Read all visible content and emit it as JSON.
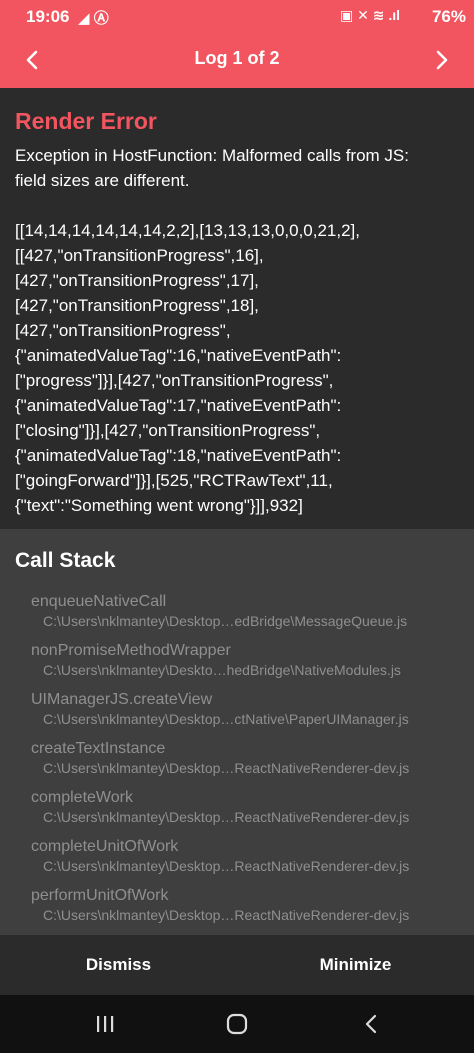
{
  "status_bar": {
    "time": "19:06",
    "left_icons": "◢ Ⓐ",
    "right_icons": "▣ ✕ ≋ .ıl",
    "battery": "76%"
  },
  "header": {
    "title": "Log 1 of 2",
    "prev_icon": "chevron-left-icon",
    "next_icon": "chevron-right-icon",
    "background": "#f2555f"
  },
  "error": {
    "heading": "Render Error",
    "message_lines": [
      "Exception in HostFunction: Malformed calls from JS:",
      "field sizes are different.",
      "",
      "[[14,14,14,14,14,14,2,2],[13,13,13,0,0,0,21,2],",
      "[[427,\"onTransitionProgress\",16],",
      "[427,\"onTransitionProgress\",17],",
      "[427,\"onTransitionProgress\",18],",
      "[427,\"onTransitionProgress\",",
      "{\"animatedValueTag\":16,\"nativeEventPath\":",
      "[\"progress\"]}],[427,\"onTransitionProgress\",",
      "{\"animatedValueTag\":17,\"nativeEventPath\":",
      "[\"closing\"]}],[427,\"onTransitionProgress\",",
      "{\"animatedValueTag\":18,\"nativeEventPath\":",
      "[\"goingForward\"]}],[525,\"RCTRawText\",11,",
      "{\"text\":\"Something went wrong\"}]],932]"
    ],
    "accent_color": "#f2555f"
  },
  "call_stack": {
    "heading": "Call Stack",
    "frames": [
      {
        "fn": "enqueueNativeCall",
        "file": "C:\\Users\\nklmantey\\Desktop…edBridge\\MessageQueue.js"
      },
      {
        "fn": "nonPromiseMethodWrapper",
        "file": "C:\\Users\\nklmantey\\Deskto…hedBridge\\NativeModules.js"
      },
      {
        "fn": "UIManagerJS.createView",
        "file": "C:\\Users\\nklmantey\\Desktop…ctNative\\PaperUIManager.js"
      },
      {
        "fn": "createTextInstance",
        "file": "C:\\Users\\nklmantey\\Desktop…ReactNativeRenderer-dev.js"
      },
      {
        "fn": "completeWork",
        "file": "C:\\Users\\nklmantey\\Desktop…ReactNativeRenderer-dev.js"
      },
      {
        "fn": "completeUnitOfWork",
        "file": "C:\\Users\\nklmantey\\Desktop…ReactNativeRenderer-dev.js"
      },
      {
        "fn": "performUnitOfWork",
        "file": "C:\\Users\\nklmantey\\Desktop…ReactNativeRenderer-dev.js"
      }
    ]
  },
  "actions": {
    "dismiss": "Dismiss",
    "minimize": "Minimize"
  },
  "system_nav": {
    "recents_icon": "recents-icon",
    "home_icon": "home-icon",
    "back_icon": "back-icon"
  }
}
